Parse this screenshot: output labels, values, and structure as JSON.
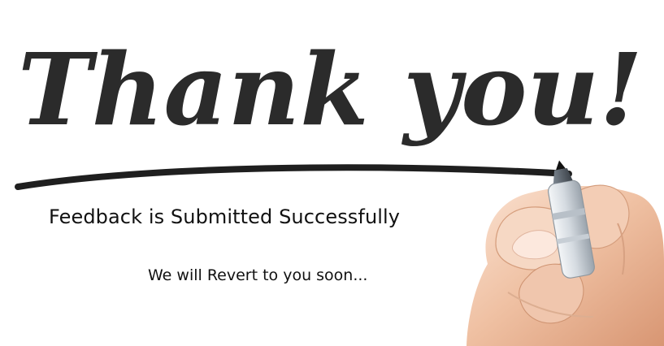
{
  "graphic": {
    "headline": "Thank you!",
    "ink_color": "#2b2b2b",
    "skin_color": "#f1c4a7",
    "marker_color": "#d9dde0"
  },
  "content": {
    "message": "Feedback is Submitted Successfully",
    "subtext": "We will Revert to you soon..."
  }
}
